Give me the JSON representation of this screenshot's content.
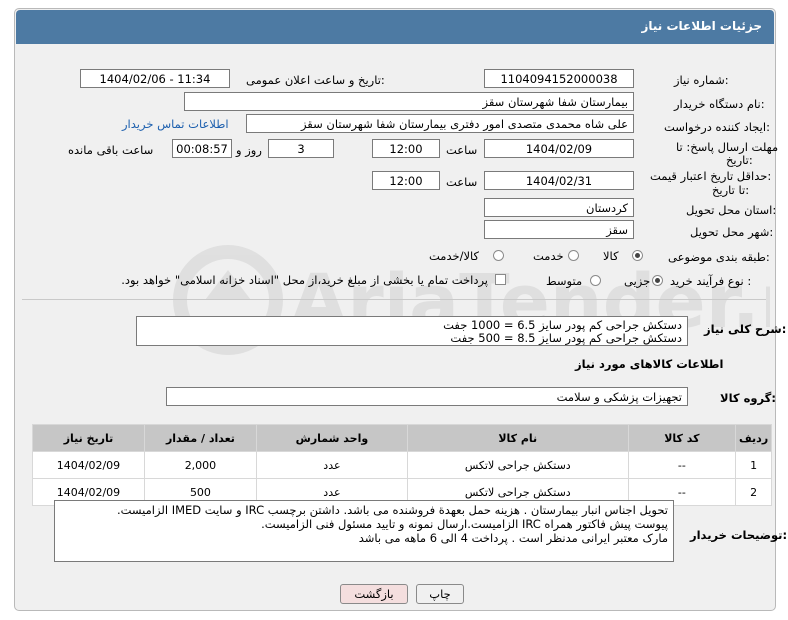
{
  "header": {
    "title": "جزئیات اطلاعات نیاز"
  },
  "fields": {
    "need_number_label": "شماره نیاز:",
    "need_number": "1104094152000038",
    "announce_label": "تاریخ و ساعت اعلان عمومی:",
    "announce_value": "1404/02/06 - 11:34",
    "buyer_org_label": "نام دستگاه خریدار:",
    "buyer_org": "بیمارستان شفا شهرستان سقز",
    "creator_label": "ایجاد کننده درخواست:",
    "creator": "علی شاه محمدی متصدی امور دفتری بیمارستان شفا شهرستان سقز",
    "contact_link": "اطلاعات تماس خریدار",
    "deadline_label_1": "مهلت ارسال پاسخ: تا",
    "deadline_label_2": "تاریخ:",
    "deadline_date": "1404/02/09",
    "hour_label": "ساعت",
    "deadline_time": "12:00",
    "days_value": "3",
    "days_label": "روز و",
    "remaining_time": "00:08:57",
    "remaining_label": "ساعت باقی مانده",
    "price_label_1": "حداقل تاریخ اعتبار قیمت:",
    "price_label_2": "تا تاریخ:",
    "price_date": "1404/02/31",
    "price_hour_label": "ساعت",
    "price_time": "12:00",
    "province_label": "استان محل تحویل:",
    "province": "کردستان",
    "city_label": "شهر محل تحویل:",
    "city": "سقز",
    "category_label": "طبقه بندی موضوعی:",
    "category_options": [
      "کالا",
      "خدمت",
      "کالا/خدمت"
    ],
    "process_label": "نوع فرآیند خرید :",
    "process_options": [
      "جزیی",
      "متوسط"
    ],
    "payment_text": "پرداخت تمام یا بخشی از مبلغ خرید،از محل \"اسناد خزانه اسلامی\" خواهد بود."
  },
  "description": {
    "label": "شرح کلی نیاز:",
    "line1": "دستکش جراحی کم پودر سایز 6.5 = 1000 جفت",
    "line2": "دستکش جراحی کم پودر سایز 8.5  = 500 جفت"
  },
  "goods": {
    "section_title": "اطلاعات کالاهای مورد نیاز",
    "group_label": "گروه کالا:",
    "group_value": "تجهیزات پزشکی و سلامت"
  },
  "table": {
    "headers": [
      "ردیف",
      "کد کالا",
      "نام کالا",
      "واحد شمارش",
      "تعداد / مقدار",
      "تاریخ نیاز"
    ],
    "rows": [
      [
        "1",
        "--",
        "دستکش جراحی لاتکس",
        "عدد",
        "2,000",
        "1404/02/09"
      ],
      [
        "2",
        "--",
        "دستکش جراحی لاتکس",
        "عدد",
        "500",
        "1404/02/09"
      ]
    ]
  },
  "buyer_notes": {
    "label": "توضیحات خریدار:",
    "line1": "تحویل اجناس  انبار بیمارستان . هزینه حمل بعهدة فروشنده می باشد.  داشتن برچسب IRC  و سایت  IMED  الزامیست.",
    "line2": "پیوست پیش فاکتور همراه IRC  الزامیست.ارسال نمونه و تایید مسئول فنی الزامیست.",
    "line3": "مارک معتبر ایرانی مدنظر است . پرداخت 4 الی 6 ماهه می باشد"
  },
  "buttons": {
    "print": "چاپ",
    "back": "بازگشت"
  },
  "watermark": {
    "text": "AriaTender.net"
  },
  "colors": {
    "header": "#4d7aa3",
    "link": "#1c5fae",
    "back_button": "#f4dede"
  }
}
